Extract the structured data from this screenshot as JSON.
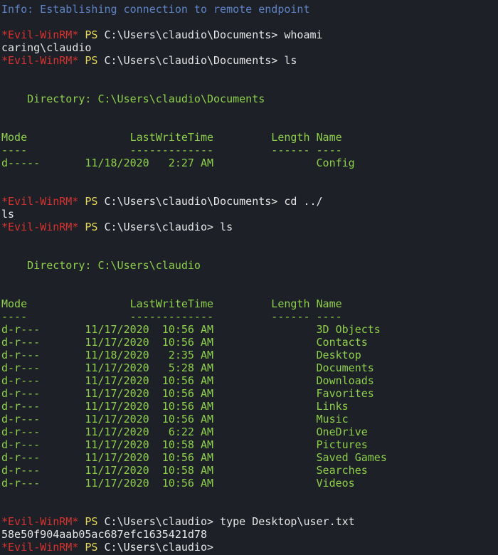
{
  "colors": {
    "background": "#1d2027",
    "info": "#5c83c6",
    "prompt_evil": "#d7322e",
    "prompt_ps": "#e8d85a",
    "output_green": "#8ed04a",
    "text_white": "#e6e6e6"
  },
  "lines": [
    {
      "type": "info",
      "text": "Info: Establishing connection to remote endpoint"
    },
    {
      "type": "blank"
    },
    {
      "type": "prompt",
      "evil": "*Evil-WinRM*",
      "ps": " PS ",
      "path": "C:\\Users\\claudio\\Documents>",
      "cmd": " whoami"
    },
    {
      "type": "out",
      "text": "caring\\claudio"
    },
    {
      "type": "prompt",
      "evil": "*Evil-WinRM*",
      "ps": " PS ",
      "path": "C:\\Users\\claudio\\Documents>",
      "cmd": " ls"
    },
    {
      "type": "blank"
    },
    {
      "type": "blank"
    },
    {
      "type": "green",
      "text": "    Directory: C:\\Users\\claudio\\Documents"
    },
    {
      "type": "blank"
    },
    {
      "type": "blank"
    },
    {
      "type": "green",
      "text": "Mode                LastWriteTime         Length Name"
    },
    {
      "type": "green",
      "text": "----                -------------         ------ ----"
    },
    {
      "type": "green",
      "text": "d-----       11/18/2020   2:27 AM                Config"
    },
    {
      "type": "blank"
    },
    {
      "type": "blank"
    },
    {
      "type": "prompt",
      "evil": "*Evil-WinRM*",
      "ps": " PS ",
      "path": "C:\\Users\\claudio\\Documents>",
      "cmd": " cd ../"
    },
    {
      "type": "out",
      "text": "ls"
    },
    {
      "type": "prompt",
      "evil": "*Evil-WinRM*",
      "ps": " PS ",
      "path": "C:\\Users\\claudio>",
      "cmd": " ls"
    },
    {
      "type": "blank"
    },
    {
      "type": "blank"
    },
    {
      "type": "green",
      "text": "    Directory: C:\\Users\\claudio"
    },
    {
      "type": "blank"
    },
    {
      "type": "blank"
    },
    {
      "type": "green",
      "text": "Mode                LastWriteTime         Length Name"
    },
    {
      "type": "green",
      "text": "----                -------------         ------ ----"
    },
    {
      "type": "green",
      "text": "d-r---       11/17/2020  10:56 AM                3D Objects"
    },
    {
      "type": "green",
      "text": "d-r---       11/17/2020  10:56 AM                Contacts"
    },
    {
      "type": "green",
      "text": "d-r---       11/18/2020   2:35 AM                Desktop"
    },
    {
      "type": "green",
      "text": "d-r---       11/17/2020   5:28 AM                Documents"
    },
    {
      "type": "green",
      "text": "d-r---       11/17/2020  10:56 AM                Downloads"
    },
    {
      "type": "green",
      "text": "d-r---       11/17/2020  10:56 AM                Favorites"
    },
    {
      "type": "green",
      "text": "d-r---       11/17/2020  10:56 AM                Links"
    },
    {
      "type": "green",
      "text": "d-r---       11/17/2020  10:56 AM                Music"
    },
    {
      "type": "green",
      "text": "d-r---       11/17/2020   6:22 AM                OneDrive"
    },
    {
      "type": "green",
      "text": "d-r---       11/17/2020  10:58 AM                Pictures"
    },
    {
      "type": "green",
      "text": "d-r---       11/17/2020  10:56 AM                Saved Games"
    },
    {
      "type": "green",
      "text": "d-r---       11/17/2020  10:58 AM                Searches"
    },
    {
      "type": "green",
      "text": "d-r---       11/17/2020  10:56 AM                Videos"
    },
    {
      "type": "blank"
    },
    {
      "type": "blank"
    },
    {
      "type": "prompt",
      "evil": "*Evil-WinRM*",
      "ps": " PS ",
      "path": "C:\\Users\\claudio>",
      "cmd": " type Desktop\\user.txt"
    },
    {
      "type": "out",
      "text": "58e50f904aab05ac687efc1635421d78"
    },
    {
      "type": "prompt",
      "evil": "*Evil-WinRM*",
      "ps": " PS ",
      "path": "C:\\Users\\claudio>",
      "cmd": ""
    }
  ]
}
